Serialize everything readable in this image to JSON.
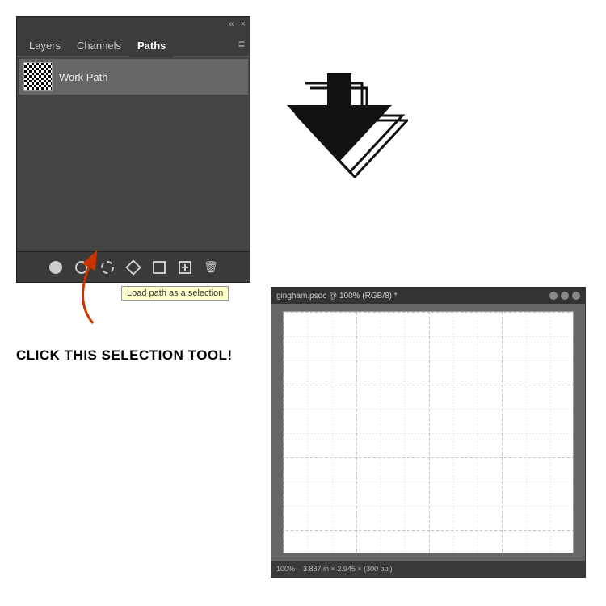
{
  "panel": {
    "tabs": [
      {
        "label": "Layers",
        "active": false
      },
      {
        "label": "Channels",
        "active": false
      },
      {
        "label": "Paths",
        "active": true
      }
    ],
    "menu_icon": "≡",
    "collapse_icon": "«",
    "close_icon": "×",
    "path_item": {
      "name": "Work Path"
    },
    "toolbar_buttons": [
      {
        "id": "fill-path",
        "tooltip": ""
      },
      {
        "id": "stroke-path",
        "tooltip": ""
      },
      {
        "id": "load-selection",
        "tooltip": "Load path as a selection"
      },
      {
        "id": "make-work-path",
        "tooltip": ""
      },
      {
        "id": "add-mask",
        "tooltip": ""
      },
      {
        "id": "new-path",
        "tooltip": ""
      },
      {
        "id": "delete-path",
        "tooltip": ""
      }
    ],
    "tooltip_text": "Load path as a selection"
  },
  "annotation": {
    "click_label": "Click this selection tool!"
  },
  "ps_window": {
    "title": "gingham.psdc @ 100% (RGB/8) *",
    "zoom": "100%",
    "dimensions": "3.887 in × 2.945 × (300 ppi)"
  },
  "colors": {
    "panel_bg": "#3c3c3c",
    "panel_dark": "#3a3a3a",
    "active_tab_color": "#ffffff",
    "path_item_bg": "#666666",
    "tooltip_bg": "#ffffcc",
    "arrow_color": "#cc0000",
    "big_arrow_color": "#111111"
  }
}
